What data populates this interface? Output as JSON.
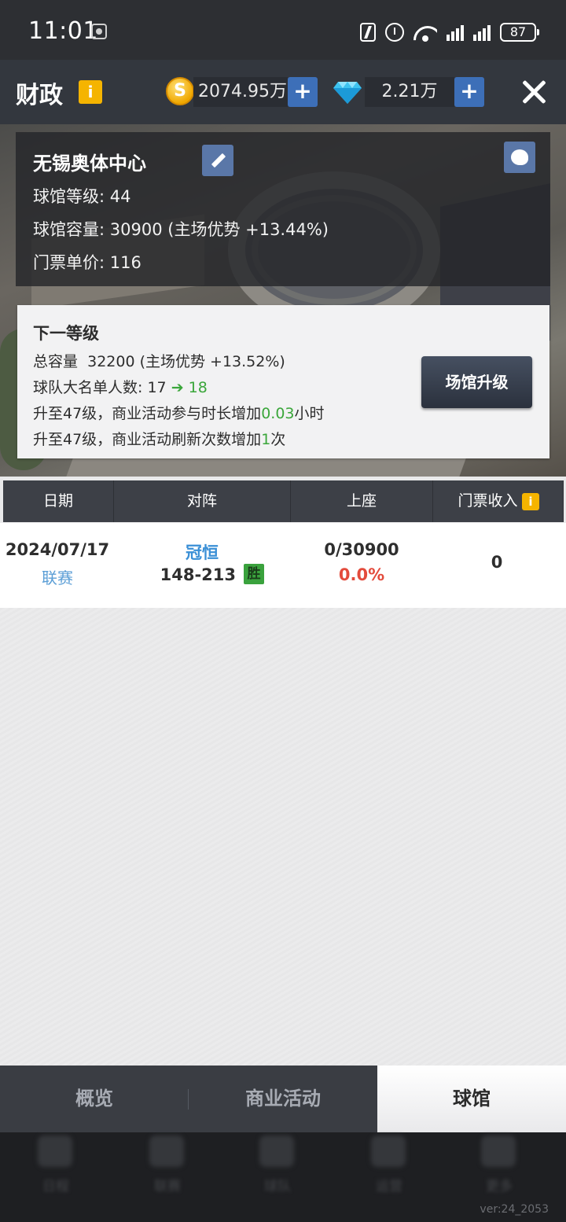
{
  "status_bar": {
    "time": "11:01",
    "battery": "87",
    "network": "6"
  },
  "header": {
    "title": "财政",
    "info_icon": "i",
    "coins": "2074.95万",
    "coin_symbol": "S",
    "gems": "2.21万",
    "plus_label": "+"
  },
  "stadium": {
    "name": "无锡奥体中心",
    "level_label": "球馆等级:",
    "level": "44",
    "capacity_label": "球馆容量:",
    "capacity": "30900 (主场优势 +13.44%)",
    "price_label": "门票单价:",
    "price": "116"
  },
  "next_level": {
    "title": "下一等级",
    "total_capacity_label": "总容量",
    "total_capacity": "32200 (主场优势 +13.52%)",
    "roster_label": "球队大名单人数:",
    "roster_from": "17",
    "roster_to": "18",
    "line3_prefix": "升至47级，商业活动参与时长增加",
    "line3_value": "0.03",
    "line3_suffix": "小时",
    "line4_prefix": "升至47级，商业活动刷新次数增加",
    "line4_value": "1",
    "line4_suffix": "次",
    "upgrade_button": "场馆升级"
  },
  "table": {
    "headers": [
      "日期",
      "对阵",
      "上座",
      "门票收入"
    ],
    "rows": [
      {
        "date": "2024/07/17",
        "type": "联赛",
        "opponent": "冠恒",
        "score": "148-213",
        "result": "胜",
        "attendance": "0/30900",
        "attendance_pct": "0.0%",
        "revenue": "0"
      }
    ]
  },
  "tabs": [
    "概览",
    "商业活动",
    "球馆"
  ],
  "active_tab": "球馆",
  "nav": [
    "日程",
    "联赛",
    "球队",
    "运营",
    "更多"
  ],
  "version": "ver:24_2053",
  "colors": {
    "accent_blue": "#3d6fb8",
    "green": "#3aa63a",
    "red": "#e34b3c",
    "info_yellow": "#f5b400"
  }
}
